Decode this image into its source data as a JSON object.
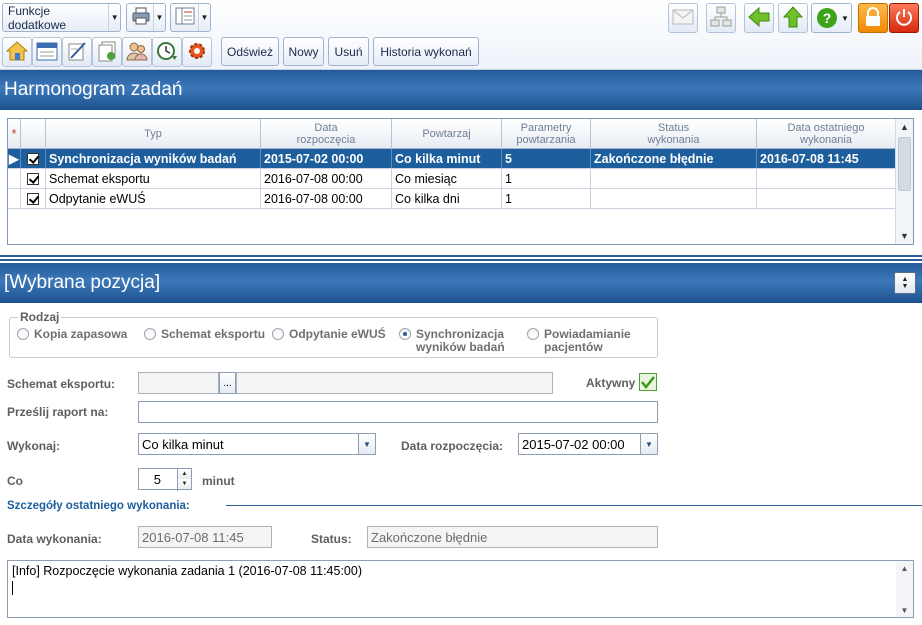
{
  "toolbar": {
    "extra_functions_label": "Funkcje dodatkowe",
    "refresh_label": "Odśwież",
    "new_label": "Nowy",
    "delete_label": "Usuń",
    "history_label": "Historia wykonań",
    "help_label": "?",
    "colors": {
      "accent": "#1d5e9c",
      "green": "#4caf1a",
      "orange": "#ff9a1a",
      "red": "#e03a1e"
    }
  },
  "schedule": {
    "title": "Harmonogram zadań",
    "columns": {
      "star": "*",
      "type": "Typ",
      "start_l1": "Data",
      "start_l2": "rozpoczęcia",
      "repeat": "Powtarzaj",
      "params_l1": "Parametry",
      "params_l2": "powtarzania",
      "status_l1": "Status",
      "status_l2": "wykonania",
      "last_l1": "Data ostatniego",
      "last_l2": "wykonania"
    },
    "rows": [
      {
        "type": "Synchronizacja wyników badań",
        "start": "2015-07-02 00:00",
        "repeat": "Co kilka minut",
        "params": "5",
        "status": "Zakończone błędnie",
        "last": "2016-07-08 11:45"
      },
      {
        "type": "Schemat eksportu",
        "start": "2016-07-08 00:00",
        "repeat": "Co miesiąc",
        "params": "1",
        "status": "",
        "last": ""
      },
      {
        "type": "Odpytanie eWUŚ",
        "start": "2016-07-08 00:00",
        "repeat": "Co kilka dni",
        "params": "1",
        "status": "",
        "last": ""
      }
    ]
  },
  "detail": {
    "title": "[Wybrana pozycja]",
    "kind_legend": "Rodzaj",
    "kinds": [
      {
        "l1": "Kopia zapasowa",
        "l2": ""
      },
      {
        "l1": "Schemat eksportu",
        "l2": ""
      },
      {
        "l1": "Odpytanie eWUŚ",
        "l2": ""
      },
      {
        "l1": "Synchronizacja",
        "l2": "wyników badań"
      },
      {
        "l1": "Powiadamianie",
        "l2": "pacjentów"
      }
    ],
    "selected_kind": "Synchronizacja wyników badań",
    "export_schema_label": "Schemat eksportu:",
    "export_schema_value": "",
    "browse_label": "...",
    "active_label": "Aktywny",
    "send_report_label": "Prześlij raport na:",
    "send_report_value": "",
    "execute_label": "Wykonaj:",
    "execute_value": "Co kilka minut",
    "start_date_label": "Data rozpoczęcia:",
    "start_date_value": "2015-07-02 00:00",
    "every_label": "Co",
    "every_value": "5",
    "every_unit": "minut",
    "last_details_label": "Szczegóły ostatniego wykonania:",
    "exec_date_label": "Data wykonania:",
    "exec_date_value": "2016-07-08 11:45",
    "status_label": "Status:",
    "status_value": "Zakończone błędnie",
    "log_text": "[Info] Rozpoczęcie wykonania zadania 1 (2016-07-08 11:45:00)"
  }
}
